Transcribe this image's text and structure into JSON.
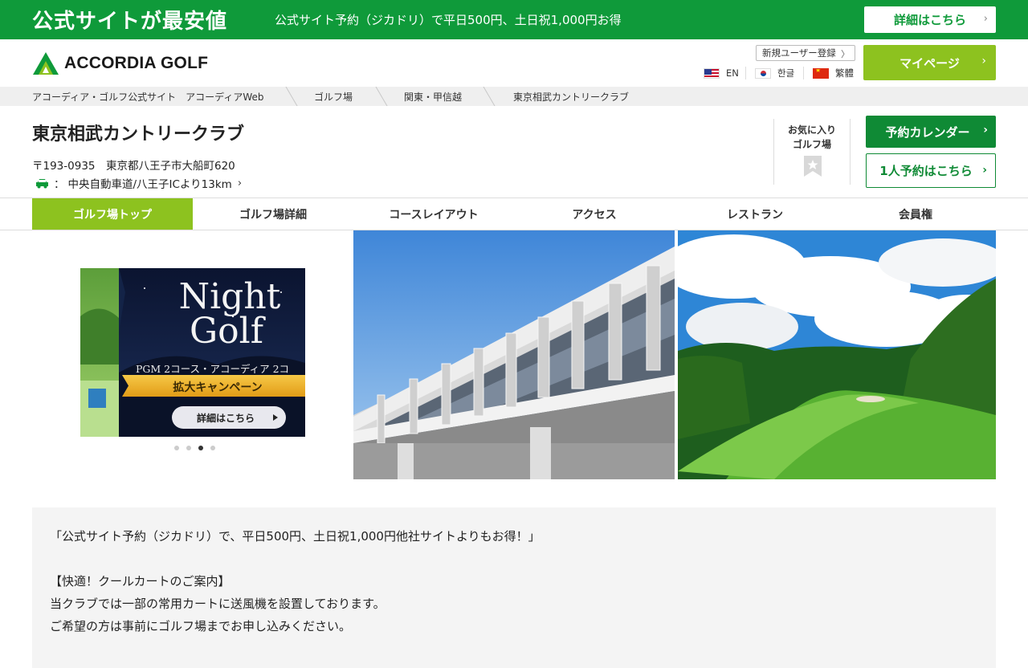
{
  "promo": {
    "title": "公式サイトが最安値",
    "text": "公式サイト予約（ジカドリ）で平日500円、土日祝1,000円お得",
    "button_label": "詳細はこちら"
  },
  "header": {
    "logo_text": "ACCORDIA GOLF",
    "register_label": "新規ユーザー登録",
    "languages": [
      {
        "label": "EN",
        "icon": "us-flag-icon"
      },
      {
        "label": "한글",
        "icon": "kr-flag-icon"
      },
      {
        "label": "繁體",
        "icon": "cn-flag-icon"
      }
    ],
    "mypage_label": "マイページ"
  },
  "breadcrumb": [
    "アコーディア・ゴルフ公式サイト　アコーディアWeb",
    "ゴルフ場",
    "関東・甲信越",
    "東京相武カントリークラブ"
  ],
  "club": {
    "name": "東京相武カントリークラブ",
    "address": "〒193-0935　東京都八王子市大船町620",
    "access_prefix": "：",
    "access": "中央自動車道/八王子ICより13km",
    "favorite_label_1": "お気に入り",
    "favorite_label_2": "ゴルフ場",
    "calendar_label": "予約カレンダー",
    "solo_label": "1人予約はこちら"
  },
  "tabs": [
    "ゴルフ場トップ",
    "ゴルフ場詳細",
    "コースレイアウト",
    "アクセス",
    "レストラン",
    "会員権"
  ],
  "banner": {
    "title_1": "Night",
    "title_2": "Golf",
    "subtitle": "PGM 2コース・アコーディア 2コ",
    "ribbon": "拡大キャンペーン",
    "button": "詳細はこちら",
    "slide_count": 4,
    "active_slide": 3
  },
  "info": {
    "lines": [
      "「公式サイト予約（ジカドリ）で、平日500円、土日祝1,000円他社サイトよりもお得！」",
      "",
      "【快適！クールカートのご案内】",
      "当クラブでは一部の常用カートに送風機を設置しております。",
      "ご希望の方は事前にゴルフ場までお申し込みください。"
    ]
  },
  "colors": {
    "brand_green": "#0f9a3a",
    "accent_lime": "#8dc21f",
    "button_green": "#0f8a35"
  }
}
